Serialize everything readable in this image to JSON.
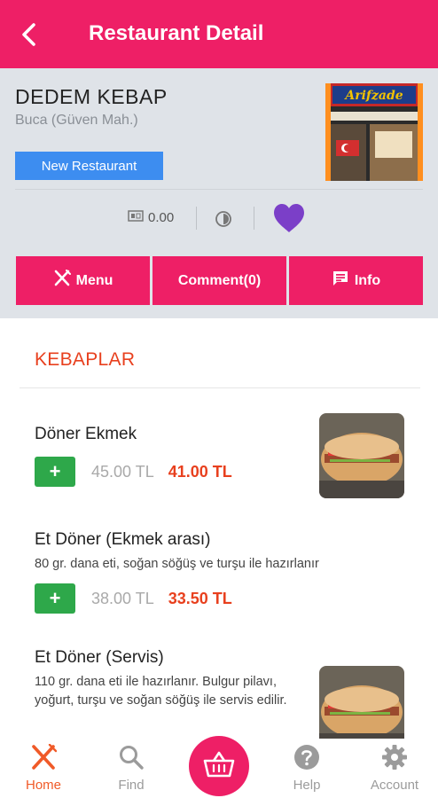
{
  "header": {
    "title": "Restaurant Detail"
  },
  "restaurant": {
    "name": "DEDEM KEBAP",
    "location": "Buca (Güven Mah.)",
    "badge": "New Restaurant",
    "min_price": "0.00",
    "photo_sign": "Arifzade"
  },
  "tabs": {
    "menu": "Menu",
    "comment": "Comment(0)",
    "info": "Info"
  },
  "category": {
    "title": "KEBAPLAR"
  },
  "items": [
    {
      "name": "Döner Ekmek",
      "desc": "",
      "old_price": "45.00 TL",
      "new_price": "41.00 TL",
      "add_label": "+"
    },
    {
      "name": "Et Döner (Ekmek arası)",
      "desc": "80 gr. dana eti, soğan söğüş ve turşu ile hazırlanır",
      "old_price": "38.00 TL",
      "new_price": "33.50 TL",
      "add_label": "+"
    },
    {
      "name": "Et Döner (Servis)",
      "desc": "110 gr. dana eti ile hazırlanır. Bulgur pilavı, yoğurt, turşu ve soğan söğüş ile servis edilir."
    }
  ],
  "nav": {
    "home": "Home",
    "find": "Find",
    "help": "Help",
    "account": "Account"
  },
  "colors": {
    "brand": "#ee1f66",
    "accent_price": "#e8401e",
    "add_button": "#2ea84a",
    "badge": "#3d8df0",
    "heart": "#7b3fc8"
  }
}
